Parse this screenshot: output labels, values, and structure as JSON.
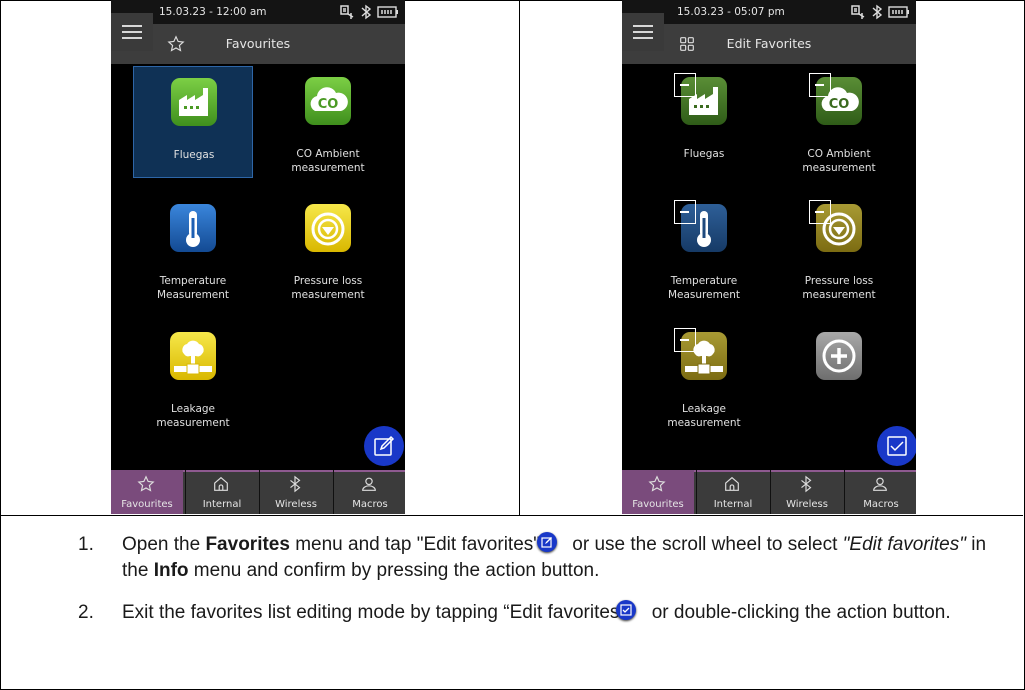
{
  "left_screen": {
    "status_time": "15.03.23 - 12:00 am",
    "title": "Favourites",
    "tiles": [
      {
        "label1": "Fluegas",
        "label2": "",
        "icon": "factory-icon",
        "color": "#5aa62f"
      },
      {
        "label1": "CO Ambient",
        "label2": "measurement",
        "icon": "co-cloud-icon",
        "color": "#5aa62f"
      },
      {
        "label1": "Temperature",
        "label2": "Measurement",
        "icon": "thermometer-icon",
        "color": "#1d5fb3"
      },
      {
        "label1": "Pressure loss",
        "label2": "measurement",
        "icon": "pressure-gauge-icon",
        "color": "#e8d310"
      },
      {
        "label1": "Leakage",
        "label2": "measurement",
        "icon": "leakage-icon",
        "color": "#e8d310"
      }
    ],
    "fab_icon": "edit-icon"
  },
  "right_screen": {
    "status_time": "15.03.23 - 05:07 pm",
    "title": "Edit Favorites",
    "tiles": [
      {
        "label1": "Fluegas",
        "label2": ""
      },
      {
        "label1": "CO Ambient",
        "label2": "measurement"
      },
      {
        "label1": "Temperature",
        "label2": "Measurement"
      },
      {
        "label1": "Pressure loss",
        "label2": "measurement"
      },
      {
        "label1": "Leakage",
        "label2": "measurement"
      }
    ],
    "add_icon": "add-favorite-icon",
    "fab_icon": "checkmark-icon"
  },
  "nav": {
    "items": [
      "Favourites",
      "Internal",
      "Wireless",
      "Macros"
    ],
    "active": "Favourites"
  },
  "instructions": {
    "step1": {
      "num": "1.",
      "t1": "Open the ",
      "b1": "Favorites",
      "t2": " menu and tap \"Edit favorites\"",
      "t3": " or use the scroll wheel to select ",
      "i1": "\"Edit favorites\"",
      "t4": " in the ",
      "b2": "Info",
      "t5": " menu and confirm by pressing the action button."
    },
    "step2": {
      "num": "2.",
      "t1": "Exit the favorites list editing mode by tapping “Edit favorites",
      "t2": " or double-clicking the action button."
    }
  },
  "colors": {
    "accent_blue": "#1938c8",
    "nav_active": "#7a4b7c",
    "green": "#5aa62f",
    "yellow": "#e8d310",
    "blue": "#1d5fb3"
  }
}
